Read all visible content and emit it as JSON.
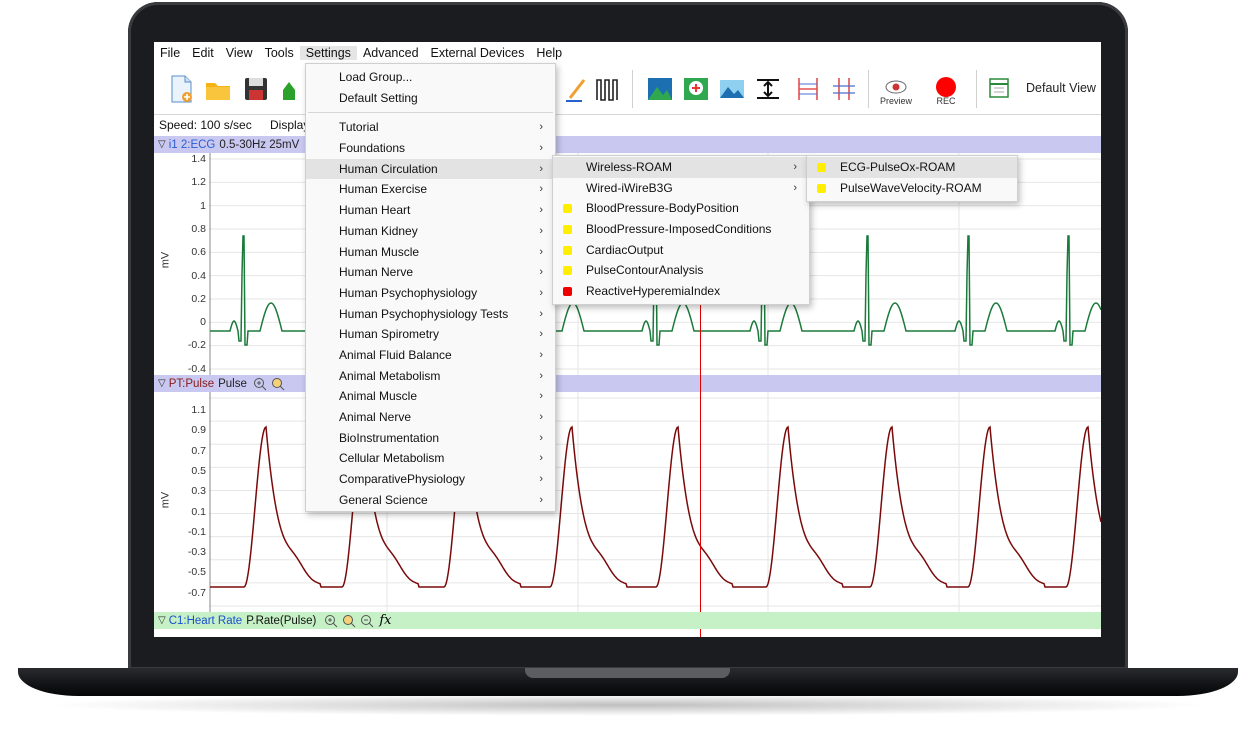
{
  "menubar": [
    "File",
    "Edit",
    "View",
    "Tools",
    "Settings",
    "Advanced",
    "External Devices",
    "Help"
  ],
  "toolbar": {
    "preview_label": "Preview",
    "rec_label": "REC",
    "default_view": "Default View"
  },
  "status": {
    "speed": "Speed: 100 s/sec",
    "display": "Display"
  },
  "channels": {
    "ecg": {
      "name": "i1 2:ECG",
      "info": "0.5-30Hz 25mV",
      "unit": "mV",
      "ticks": [
        "1.4",
        "1.2",
        "1",
        "0.8",
        "0.6",
        "0.4",
        "0.2",
        "0",
        "-0.2",
        "-0.4"
      ]
    },
    "pulse": {
      "name": "PT:Pulse",
      "info": "Pulse",
      "unit": "mV",
      "ticks": [
        "1.1",
        "0.9",
        "0.7",
        "0.5",
        "0.3",
        "0.1",
        "-0.1",
        "-0.3",
        "-0.5",
        "-0.7"
      ]
    },
    "hr": {
      "name": "C1:Heart Rate",
      "info": "P.Rate(Pulse)",
      "fx": "fx"
    }
  },
  "settings_menu": {
    "top": [
      "Load Group...",
      "Default Setting"
    ],
    "items": [
      "Tutorial",
      "Foundations",
      "Human Circulation",
      "Human Exercise",
      "Human Heart",
      "Human Kidney",
      "Human Muscle",
      "Human Nerve",
      "Human Psychophysiology",
      "Human Psychophysiology Tests",
      "Human Spirometry",
      "Animal Fluid Balance",
      "Animal Metabolism",
      "Animal Muscle",
      "Animal Nerve",
      "BioInstrumentation",
      "Cellular Metabolism",
      "ComparativePhysiology",
      "General Science"
    ]
  },
  "circulation_menu": {
    "submenus": [
      "Wireless-ROAM",
      "Wired-iWireB3G"
    ],
    "items": [
      {
        "label": "BloodPressure-BodyPosition",
        "color": "#ffee00"
      },
      {
        "label": "BloodPressure-ImposedConditions",
        "color": "#ffee00"
      },
      {
        "label": "CardiacOutput",
        "color": "#ffee00"
      },
      {
        "label": "PulseContourAnalysis",
        "color": "#ffee00"
      },
      {
        "label": "ReactiveHyperemiaIndex",
        "color": "#ee0000"
      }
    ]
  },
  "roam_menu": {
    "items": [
      {
        "label": "ECG-PulseOx-ROAM",
        "color": "#ffee00"
      },
      {
        "label": "PulseWaveVelocity-ROAM",
        "color": "#ffee00"
      }
    ]
  },
  "colors": {
    "ecg": "#1a7a3a",
    "pulse": "#7a0a0a",
    "cursor": "#e00000"
  }
}
